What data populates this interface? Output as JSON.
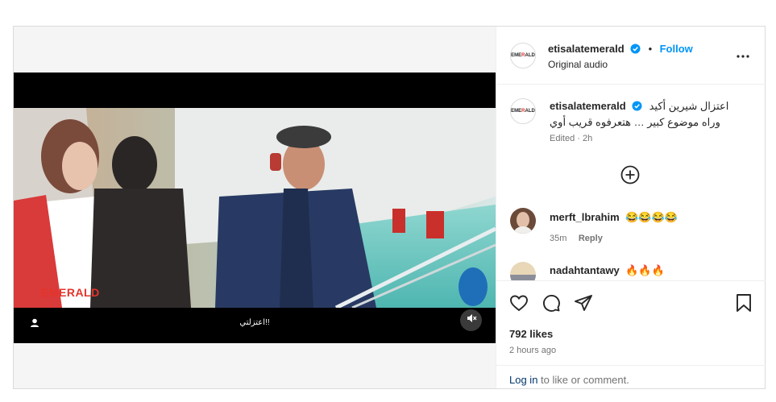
{
  "media": {
    "watermark": "EMERALD",
    "subtitle": "اعتزلتي!!",
    "icons": {
      "user": "user-icon",
      "mute": "muted-speaker-icon"
    }
  },
  "header": {
    "username": "etisalatemerald",
    "follow_label": "Follow",
    "subline": "Original audio",
    "avatar_text_pre": "EME",
    "avatar_text_r": "R",
    "avatar_text_post": "ALD"
  },
  "caption": {
    "username": "etisalatemerald",
    "line1": "اعتزال شيرين أكيد",
    "line2": "وراه موضوع كبير … هتعرفوه قريب أوي",
    "meta": "Edited · 2h"
  },
  "comments": [
    {
      "username": "merft_lbrahim",
      "text": "😂😂😂😂",
      "time": "35m",
      "reply_label": "Reply"
    },
    {
      "username": "nadahtantawy",
      "text": "🔥🔥🔥"
    }
  ],
  "stats": {
    "likes": "792 likes",
    "time_ago": "2 hours ago"
  },
  "login": {
    "link": "Log in",
    "rest": " to like or comment."
  },
  "colors": {
    "accent": "#0095f6",
    "brand_red": "#e4342b"
  }
}
